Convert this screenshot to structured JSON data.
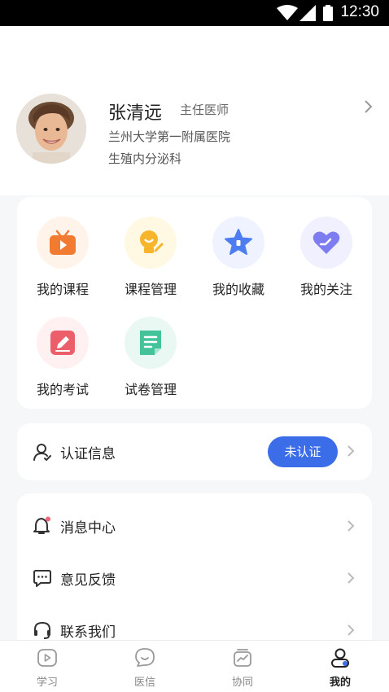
{
  "status_bar": {
    "time": "12:30"
  },
  "profile": {
    "name": "张清远",
    "title": "主任医师",
    "hospital": "兰州大学第一附属医院",
    "department": "生殖内分泌科"
  },
  "grid": {
    "items": [
      {
        "label": "我的课程",
        "icon": "tv-play-icon",
        "color": "#f27b32",
        "bg": "#fff3ea"
      },
      {
        "label": "课程管理",
        "icon": "lightbulb-edit-icon",
        "color": "#f6b52a",
        "bg": "#fff8e3"
      },
      {
        "label": "我的收藏",
        "icon": "star-icon",
        "color": "#4d7df0",
        "bg": "#eef3ff"
      },
      {
        "label": "我的关注",
        "icon": "heart-icon",
        "color": "#7d7cf0",
        "bg": "#f0f0ff"
      },
      {
        "label": "我的考试",
        "icon": "pencil-icon",
        "color": "#ec5f6a",
        "bg": "#fff0f1"
      },
      {
        "label": "试卷管理",
        "icon": "document-icon",
        "color": "#44c29a",
        "bg": "#e9f8f2"
      }
    ]
  },
  "auth": {
    "label": "认证信息",
    "status": "未认证"
  },
  "menu": {
    "items": [
      {
        "label": "消息中心"
      },
      {
        "label": "意见反馈"
      },
      {
        "label": "联系我们"
      }
    ]
  },
  "tabbar": {
    "tabs": [
      {
        "label": "学习"
      },
      {
        "label": "医信"
      },
      {
        "label": "协同"
      },
      {
        "label": "我的"
      }
    ],
    "active": "我的"
  },
  "colors": {
    "accent": "#3b6de8",
    "notify_dot": "#f0657a"
  }
}
